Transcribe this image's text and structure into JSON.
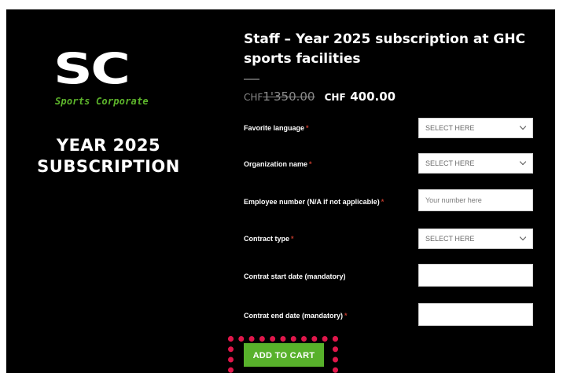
{
  "logo": {
    "letters": "SC",
    "tagline": "Sports Corporate"
  },
  "promo": {
    "title": "YEAR 2025 SUBSCRIPTION"
  },
  "product": {
    "title": "Staff – Year 2025 subscription at GHC sports facilities",
    "old_price_currency": "CHF",
    "old_price_amount": "1'350.00",
    "new_price_currency": "CHF",
    "new_price_amount": "400.00"
  },
  "form": {
    "fields": [
      {
        "label": "Favorite language",
        "required_mark": "*",
        "type": "select",
        "value": "SELECT HERE"
      },
      {
        "label": "Organization name",
        "required_mark": "*",
        "type": "select",
        "value": "SELECT HERE"
      },
      {
        "label": "Employee number (N/A if not applicable)",
        "required_mark": "*",
        "type": "input",
        "placeholder": "Your number here"
      },
      {
        "label": "Contract type",
        "required_mark": "*",
        "type": "select",
        "value": "SELECT HERE"
      },
      {
        "label": "Contrat start date (mandatory)",
        "required_mark": "",
        "type": "input",
        "placeholder": ""
      },
      {
        "label": "Contrat end date (mandatory)",
        "required_mark": "*",
        "type": "input",
        "placeholder": ""
      }
    ],
    "add_to_cart_label": "ADD TO CART"
  },
  "colors": {
    "background": "#000000",
    "accent_green": "#58b12b",
    "highlight_red": "#e0174b"
  }
}
